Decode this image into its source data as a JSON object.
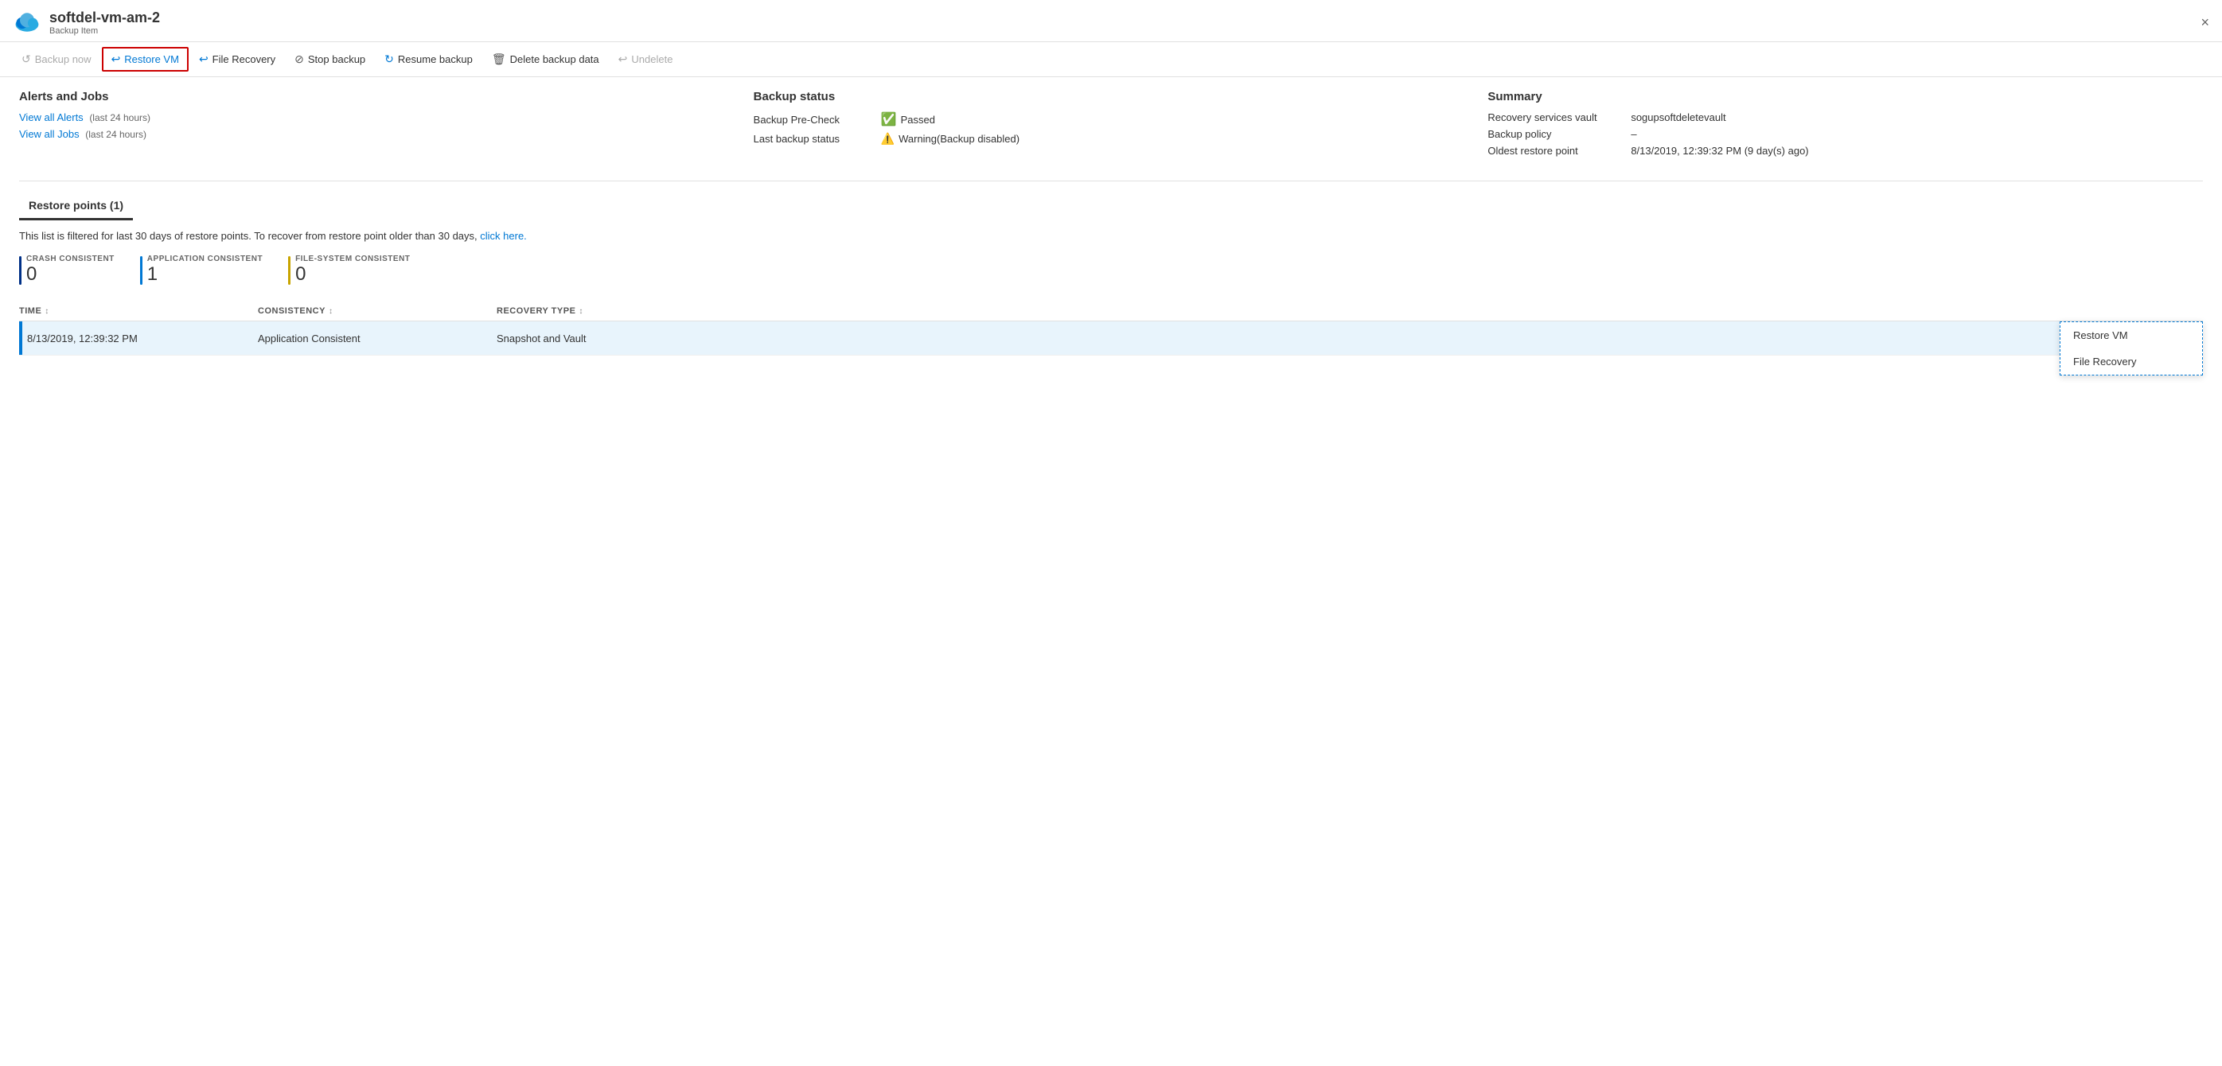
{
  "titleBar": {
    "title": "softdel-vm-am-2",
    "subtitle": "Backup Item",
    "closeLabel": "×"
  },
  "toolbar": {
    "buttons": [
      {
        "id": "backup-now",
        "icon": "↺",
        "label": "Backup now",
        "state": "disabled"
      },
      {
        "id": "restore-vm",
        "icon": "↩",
        "label": "Restore VM",
        "state": "active"
      },
      {
        "id": "file-recovery",
        "icon": "↩",
        "label": "File Recovery",
        "state": "normal"
      },
      {
        "id": "stop-backup",
        "icon": "⊘",
        "label": "Stop backup",
        "state": "normal"
      },
      {
        "id": "resume-backup",
        "icon": "↻",
        "label": "Resume backup",
        "state": "normal"
      },
      {
        "id": "delete-backup",
        "icon": "🗑",
        "label": "Delete backup data",
        "state": "normal"
      },
      {
        "id": "undelete",
        "icon": "↩",
        "label": "Undelete",
        "state": "disabled"
      }
    ]
  },
  "alertsAndJobs": {
    "sectionTitle": "Alerts and Jobs",
    "viewAllAlerts": "View all Alerts",
    "viewAllAlertsNote": "(last 24 hours)",
    "viewAllJobs": "View all Jobs",
    "viewAllJobsNote": "(last 24 hours)"
  },
  "backupStatus": {
    "sectionTitle": "Backup status",
    "preCheckLabel": "Backup Pre-Check",
    "preCheckStatus": "Passed",
    "lastBackupLabel": "Last backup status",
    "lastBackupStatus": "Warning(Backup disabled)"
  },
  "summary": {
    "sectionTitle": "Summary",
    "vaultLabel": "Recovery services vault",
    "vaultValue": "sogupsoftdeletevault",
    "policyLabel": "Backup policy",
    "policyValue": "–",
    "oldestLabel": "Oldest restore point",
    "oldestValue": "8/13/2019, 12:39:32 PM (9 day(s) ago)"
  },
  "restorePoints": {
    "tabLabel": "Restore points (1)",
    "filterNote": "This list is filtered for last 30 days of restore points. To recover from restore point older than 30 days,",
    "filterLinkText": "click here.",
    "consistencyItems": [
      {
        "type": "CRASH CONSISTENT",
        "count": "0",
        "barClass": "blue-dark"
      },
      {
        "type": "APPLICATION CONSISTENT",
        "count": "1",
        "barClass": "blue-mid"
      },
      {
        "type": "FILE-SYSTEM CONSISTENT",
        "count": "0",
        "barClass": "yellow"
      }
    ],
    "tableHeaders": [
      {
        "label": "TIME",
        "sortable": true
      },
      {
        "label": "CONSISTENCY",
        "sortable": true
      },
      {
        "label": "RECOVERY TYPE",
        "sortable": true
      },
      {
        "label": "",
        "sortable": false
      }
    ],
    "tableRows": [
      {
        "time": "8/13/2019, 12:39:32 PM",
        "consistency": "Application Consistent",
        "recoveryType": "Snapshot and Vault"
      }
    ],
    "contextMenu": {
      "visible": true,
      "items": [
        "Restore VM",
        "File Recovery"
      ]
    }
  }
}
